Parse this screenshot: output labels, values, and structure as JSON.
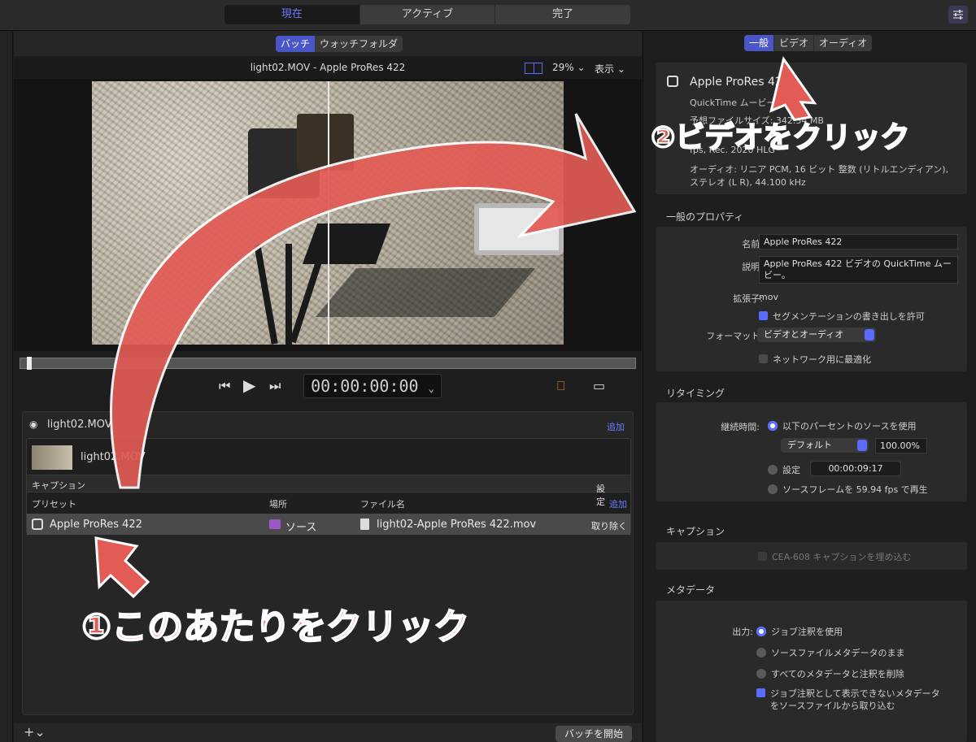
{
  "top_tabs": [
    "現在",
    "アクティブ",
    "完了"
  ],
  "viewer": {
    "mode_tabs": [
      "バッチ",
      "ウォッチフォルダ"
    ],
    "title": "light02.MOV - Apple ProRes 422",
    "zoom": "29%",
    "show_label": "表示",
    "timecode": "00:00:00:00"
  },
  "batch": {
    "file_name": "light02.MOV",
    "add_label": "追加",
    "clip_name": "light02.MOV",
    "caption_label": "キャプション",
    "settings_label": "設定",
    "columns": [
      "プリセット",
      "場所",
      "ファイル名"
    ],
    "add2_label": "追加",
    "row": {
      "preset": "Apple ProRes 422",
      "location": "ソース",
      "filename": "light02-Apple ProRes 422.mov",
      "remove": "取り除く"
    },
    "start_button": "バッチを開始"
  },
  "inspector": {
    "tabs": [
      "一般",
      "ビデオ",
      "オーディオ"
    ],
    "summary": {
      "title": "Apple ProRes 422",
      "subtitle": "QuickTime ムービー",
      "size": "予想ファイルサイズ: 342.34 MB",
      "video": "fps, Rec. 2020 HLG",
      "audio": "オーディオ: リニア PCM, 16 ビット 整数 (リトルエンディアン), ステレオ (L R), 44.100 kHz"
    },
    "general_title": "一般のプロパティ",
    "name_label": "名前:",
    "name_value": "Apple ProRes 422",
    "desc_label": "説明:",
    "desc_value": "Apple ProRes 422 ビデオの QuickTime ムービー。",
    "ext_label": "拡張子:",
    "ext_value": "mov",
    "segment_chk": "セグメンテーションの書き出しを許可",
    "format_label": "フォーマット:",
    "format_value": "ビデオとオーディオ",
    "network_chk": "ネットワーク用に最適化",
    "retiming_title": "リタイミング",
    "duration_label": "継続時間:",
    "retime_opt1": "以下のパーセントのソースを使用",
    "retime_default": "デフォルト",
    "retime_percent": "100.00%",
    "retime_opt2": "設定",
    "retime_tc": "00:00:09:17",
    "retime_opt3": "ソースフレームを 59.94 fps で再生",
    "caption_title": "キャプション",
    "cea_chk": "CEA-608 キャプションを埋め込む",
    "meta_title": "メタデータ",
    "output_label": "出力:",
    "meta_opt1": "ジョブ注釈を使用",
    "meta_opt2": "ソースファイルメタデータのまま",
    "meta_opt3": "すべてのメタデータと注釈を削除",
    "meta_chk_l1": "ジョブ注釈として表示できないメタデータ",
    "meta_chk_l2": "をソースファイルから取り込む"
  },
  "annotations": {
    "step1": "①このあたりをクリック",
    "step2": "②ビデオをクリック"
  },
  "colors": {
    "accent": "#5a6cff",
    "annotation": "#e25b55"
  }
}
